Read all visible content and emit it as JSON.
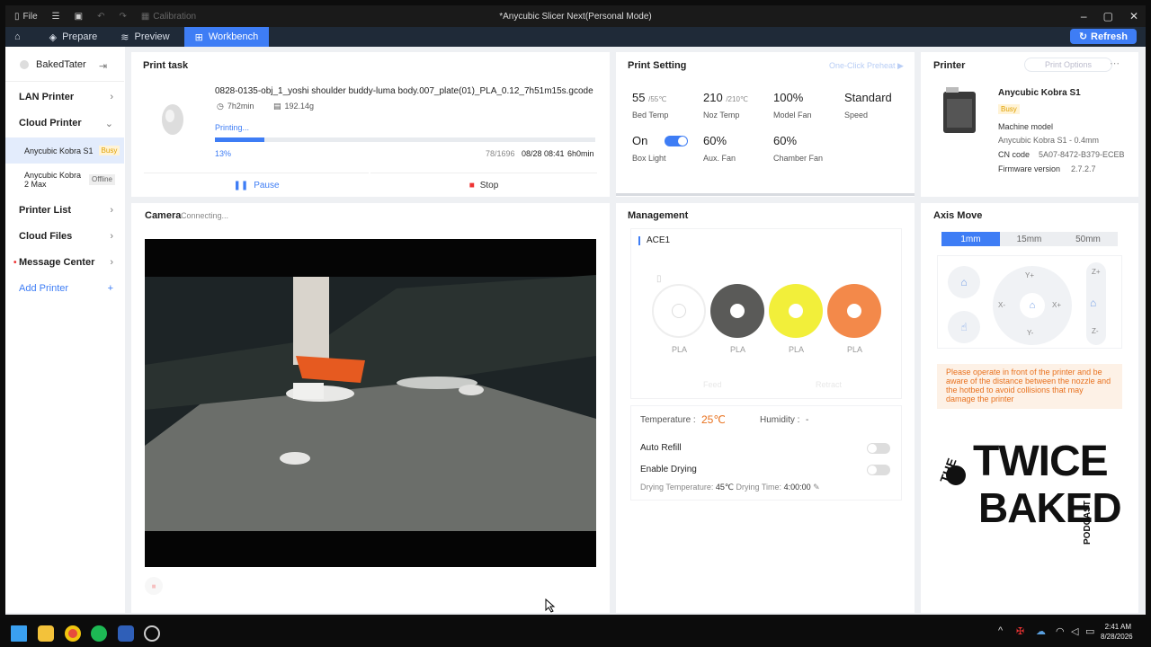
{
  "titlebar": {
    "file_label": "File",
    "calibration_label": "Calibration",
    "window_title": "*Anycubic Slicer Next(Personal Mode)"
  },
  "tabs": [
    {
      "label": "Prepare"
    },
    {
      "label": "Preview"
    },
    {
      "label": "Workbench"
    }
  ],
  "refresh_label": "Refresh",
  "sidebar": {
    "user": "BakedTater",
    "lan_printer": "LAN Printer",
    "cloud_printer": "Cloud Printer",
    "printer1": {
      "name": "Anycubic Kobra S1",
      "status": "Busy"
    },
    "printer2": {
      "name": "Anycubic Kobra 2 Max",
      "status": "Offline"
    },
    "printer_list": "Printer List",
    "cloud_files": "Cloud Files",
    "message_center": "Message Center",
    "add_printer": "Add Printer"
  },
  "print_task": {
    "title": "Print task",
    "filename": "0828-0135-obj_1_yoshi shoulder buddy-luma body.007_plate(01)_PLA_0.12_7h51m15s.gcode",
    "duration": "7h2min",
    "weight": "192.14g",
    "status": "Printing...",
    "progress_text": "13%",
    "progress": 0.13,
    "layers": "78/1696",
    "eta": "08/28 08:41",
    "remaining": "6h0min",
    "pause_label": "Pause",
    "stop_label": "Stop"
  },
  "print_setting": {
    "title": "Print Setting",
    "preheat_label": "One-Click Preheat",
    "bed_temp": "55",
    "bed_target": "/55℃",
    "bed_label": "Bed Temp",
    "noz_temp": "210",
    "noz_target": "/210℃",
    "noz_label": "Noz Temp",
    "model_fan": "100%",
    "model_fan_label": "Model Fan",
    "speed": "Standard",
    "speed_label": "Speed",
    "box_light": "On",
    "box_light_label": "Box Light",
    "aux_fan": "60%",
    "aux_fan_label": "Aux. Fan",
    "chamber_fan": "60%",
    "chamber_fan_label": "Chamber Fan"
  },
  "printer": {
    "title": "Printer",
    "options_label": "Print Options",
    "name": "Anycubic Kobra S1",
    "status": "Busy",
    "machine_model_label": "Machine model",
    "machine_model": "Anycubic Kobra S1 - 0.4mm",
    "cn_label": "CN code",
    "cn_code": "5A07-8472-B379-ECEB",
    "fw_label": "Firmware version",
    "fw_version": "2.7.2.7"
  },
  "camera": {
    "title": "Camera",
    "status": "Connecting..."
  },
  "management": {
    "title": "Management",
    "ace": "ACE1",
    "slots": [
      {
        "label": "PLA",
        "color": "#ffffff"
      },
      {
        "label": "PLA",
        "color": "#5a5a58"
      },
      {
        "label": "PLA",
        "color": "#f2ef3a"
      },
      {
        "label": "PLA",
        "color": "#f3894a"
      }
    ],
    "feed_label": "Feed",
    "retract_label": "Retract",
    "temperature_label": "Temperature :",
    "temperature": "25℃",
    "humidity_label": "Humidity :",
    "humidity": "-",
    "auto_refill": "Auto Refill",
    "enable_drying": "Enable Drying",
    "drying_temp_label": "Drying Temperature:",
    "drying_temp": "45℃",
    "drying_time_label": "Drying Time:",
    "drying_time": "4:00:00"
  },
  "axis": {
    "title": "Axis Move",
    "steps": [
      "1mm",
      "15mm",
      "50mm"
    ],
    "warning": "Please operate in front of the printer and be aware of the distance between the nozzle and the hotbed to avoid collisions that may damage the printer",
    "y_plus": "Y+",
    "y_minus": "Y-",
    "x_minus": "X-",
    "x_plus": "X+",
    "z_plus": "Z+",
    "z_minus": "Z-"
  },
  "logo": {
    "line1": "THE",
    "line2": "TWICE",
    "line3": "BAKED",
    "line4": "PODCAST"
  },
  "taskbar": {
    "time": "2:41 AM",
    "date": "8/28/2026"
  },
  "colors": {
    "accent": "#3e7df5",
    "busy": "#e0a000",
    "temp": "#e8711e",
    "warning_bg": "#fdf1e6",
    "warning_text": "#e8711e"
  }
}
